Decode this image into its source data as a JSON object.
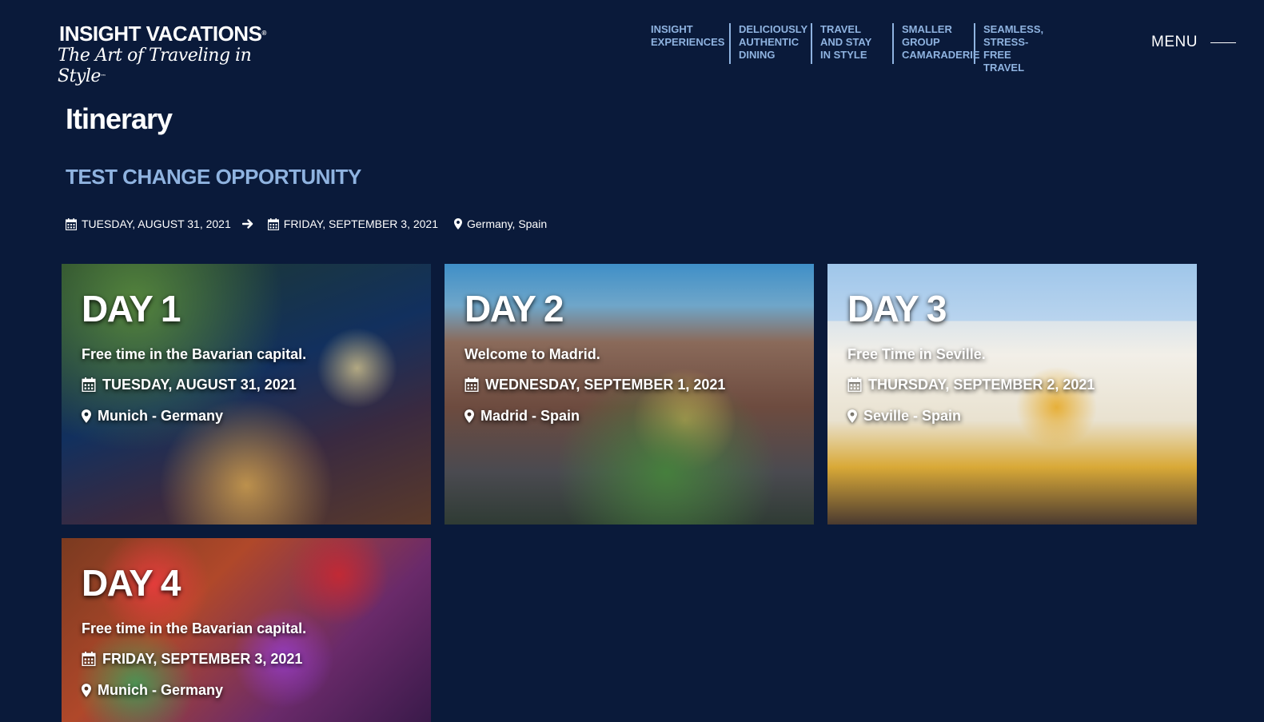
{
  "brand": {
    "name": "INSIGHT VACATIONS",
    "tagline": "The Art of Traveling in Style"
  },
  "nav": {
    "items": [
      {
        "label": "INSIGHT EXPERIENCES"
      },
      {
        "label": "DELICIOUSLY AUTHENTIC DINING"
      },
      {
        "label": "TRAVEL AND STAY IN STYLE"
      },
      {
        "label": "SMALLER GROUP CAMARADERIE"
      },
      {
        "label": "SEAMLESS, STRESS-FREE TRAVEL"
      }
    ],
    "menu_label": "MENU"
  },
  "page": {
    "title": "Itinerary",
    "trip_name": "TEST CHANGE OPPORTUNITY",
    "start_date": "TUESDAY, AUGUST 31, 2021",
    "end_date": "FRIDAY, SEPTEMBER 3, 2021",
    "countries": "Germany, Spain"
  },
  "days": [
    {
      "title": "DAY 1",
      "description": "Free time in the Bavarian capital.",
      "date": "TUESDAY, AUGUST 31, 2021",
      "location": "Munich - Germany"
    },
    {
      "title": "DAY 2",
      "description": "Welcome to Madrid.",
      "date": "WEDNESDAY, SEPTEMBER 1, 2021",
      "location": "Madrid - Spain"
    },
    {
      "title": "DAY 3",
      "description": "Free Time in Seville.",
      "date": "THURSDAY, SEPTEMBER 2, 2021",
      "location": "Seville - Spain"
    },
    {
      "title": "DAY 4",
      "description": "Free time in the Bavarian capital.",
      "date": "FRIDAY, SEPTEMBER 3, 2021",
      "location": "Munich - Germany"
    }
  ],
  "colors": {
    "background": "#0a1a3a",
    "accent": "#8fb3e0",
    "text": "#ffffff"
  }
}
